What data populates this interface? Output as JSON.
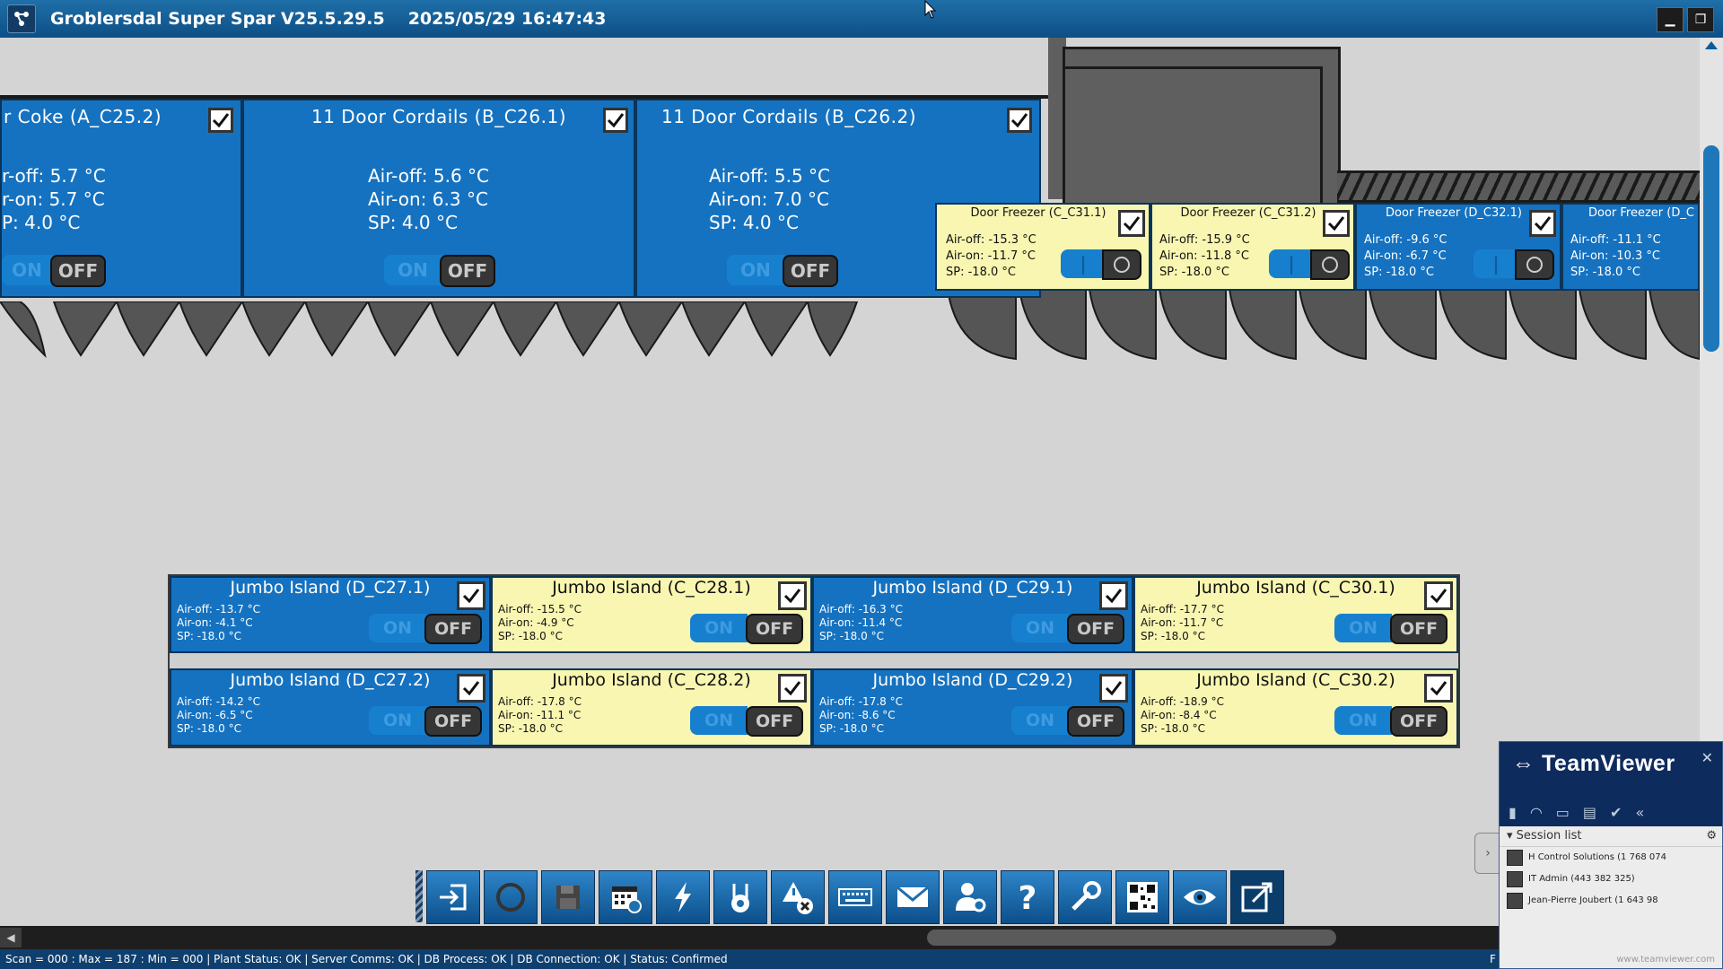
{
  "window": {
    "title": "Groblersdal Super Spar V25.5.29.5",
    "datetime": "2025/05/29 16:47:43",
    "minimize_label": "▁",
    "restore_label": "❐"
  },
  "cases_top": [
    {
      "title": "r Coke (A_C25.2)",
      "air_off": "r-off: 5.7 °C",
      "air_on": "r-on: 5.7 °C",
      "sp": "P: 4.0 °C",
      "on": "ON",
      "off": "OFF"
    },
    {
      "title": "11 Door Cordails (B_C26.1)",
      "air_off": "Air-off: 5.6 °C",
      "air_on": "Air-on: 6.3 °C",
      "sp": "SP: 4.0 °C",
      "on": "ON",
      "off": "OFF"
    },
    {
      "title": "11 Door Cordails (B_C26.2)",
      "air_off": "Air-off: 5.5 °C",
      "air_on": "Air-on: 7.0 °C",
      "sp": "SP: 4.0 °C",
      "on": "ON",
      "off": "OFF"
    }
  ],
  "freezers": [
    {
      "title": "Door Freezer (C_C31.1)",
      "air_off": "Air-off: -15.3 °C",
      "air_on": "Air-on: -11.7 °C",
      "sp": "SP: -18.0 °C",
      "color": "yellow"
    },
    {
      "title": "Door Freezer (C_C31.2)",
      "air_off": "Air-off: -15.9 °C",
      "air_on": "Air-on: -11.8 °C",
      "sp": "SP: -18.0 °C",
      "color": "yellow"
    },
    {
      "title": "Door Freezer (D_C32.1)",
      "air_off": "Air-off: -9.6 °C",
      "air_on": "Air-on: -6.7 °C",
      "sp": "SP: -18.0 °C",
      "color": "blue"
    },
    {
      "title": "Door Freezer (D_C",
      "air_off": "Air-off: -11.1 °C",
      "air_on": "Air-on: -10.3 °C",
      "sp": "SP: -18.0 °C",
      "color": "blue"
    }
  ],
  "islands": [
    {
      "title": "Jumbo Island (D_C27.1)",
      "air_off": "Air-off: -13.7 °C",
      "air_on": "Air-on: -4.1 °C",
      "sp": "SP: -18.0 °C",
      "color": "blue",
      "on": "ON",
      "off": "OFF"
    },
    {
      "title": "Jumbo Island (C_C28.1)",
      "air_off": "Air-off: -15.5 °C",
      "air_on": "Air-on: -4.9 °C",
      "sp": "SP: -18.0 °C",
      "color": "yellow",
      "on": "ON",
      "off": "OFF"
    },
    {
      "title": "Jumbo Island (D_C29.1)",
      "air_off": "Air-off: -16.3 °C",
      "air_on": "Air-on: -11.4 °C",
      "sp": "SP: -18.0 °C",
      "color": "blue",
      "on": "ON",
      "off": "OFF"
    },
    {
      "title": "Jumbo Island (C_C30.1)",
      "air_off": "Air-off: -17.7 °C",
      "air_on": "Air-on: -11.7 °C",
      "sp": "SP: -18.0 °C",
      "color": "yellow",
      "on": "ON",
      "off": "OFF"
    },
    {
      "title": "Jumbo Island (D_C27.2)",
      "air_off": "Air-off: -14.2 °C",
      "air_on": "Air-on: -6.5 °C",
      "sp": "SP: -18.0 °C",
      "color": "blue",
      "on": "ON",
      "off": "OFF"
    },
    {
      "title": "Jumbo Island (C_C28.2)",
      "air_off": "Air-off: -17.8 °C",
      "air_on": "Air-on: -11.1 °C",
      "sp": "SP: -18.0 °C",
      "color": "yellow",
      "on": "ON",
      "off": "OFF"
    },
    {
      "title": "Jumbo Island (D_C29.2)",
      "air_off": "Air-off: -17.8 °C",
      "air_on": "Air-on: -8.6 °C",
      "sp": "SP: -18.0 °C",
      "color": "blue",
      "on": "ON",
      "off": "OFF"
    },
    {
      "title": "Jumbo Island (C_C30.2)",
      "air_off": "Air-off: -18.9 °C",
      "air_on": "Air-on: -8.4 °C",
      "sp": "SP: -18.0 °C",
      "color": "yellow",
      "on": "ON",
      "off": "OFF"
    }
  ],
  "toolbar_icons": [
    "login-icon",
    "refresh-icon",
    "save-icon",
    "calendar-icon",
    "lightning-icon",
    "defrost-icon",
    "alarm-clear-icon",
    "keyboard-icon",
    "mail-icon",
    "user-settings-icon",
    "help-icon",
    "tools-icon",
    "qr-code-icon",
    "eye-icon",
    "export-icon"
  ],
  "status": "Scan = 000 : Max = 187 : Min = 000  |  Plant Status: OK  |  Server Comms: OK  |  DB Process: OK  |  DB Connection:  OK  |  Status: Confirmed",
  "status_right": "F",
  "teamviewer": {
    "brand": "TeamViewer",
    "close": "✕",
    "session_list": "Session list",
    "sessions": [
      "H Control Solutions (1 768 074",
      "IT Admin (443 382 325)",
      "Jean-Pierre Joubert (1 643 98"
    ],
    "footer": "www.teamviewer.com"
  },
  "colors": {
    "panel_blue": "#1572c0",
    "panel_yellow": "#f8f6b0",
    "title_bar": "#0d4f86"
  }
}
